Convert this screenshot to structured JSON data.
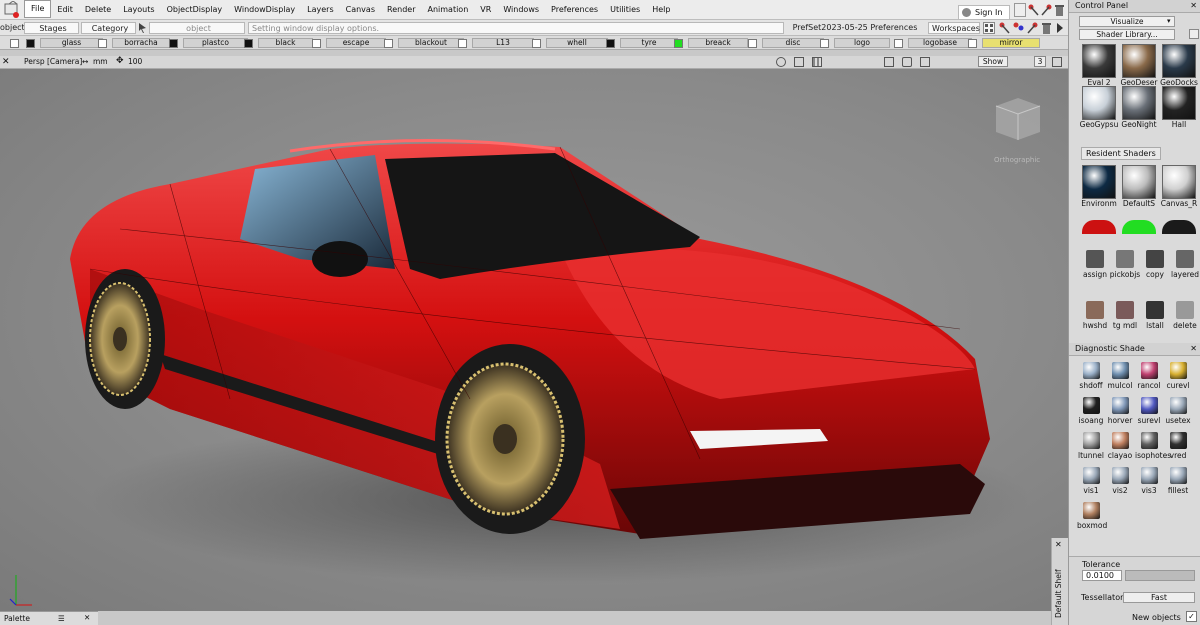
{
  "menu": {
    "items": [
      "File",
      "Edit",
      "Delete",
      "Layouts",
      "ObjectDisplay",
      "WindowDisplay",
      "Layers",
      "Canvas",
      "Render",
      "Animation",
      "VR",
      "Windows",
      "Preferences",
      "Utilities",
      "Help"
    ],
    "sign_in": "Sign In"
  },
  "toolbar": {
    "mode_label": "object",
    "stages": "Stages",
    "category": "Category",
    "object_field": "object",
    "status_text": "Setting window display options.",
    "prefset": "PrefSet2023-05-25 Preferences",
    "workspaces": "Workspaces"
  },
  "layers": [
    "glass",
    "borracha",
    "plastco",
    "black",
    "escape",
    "blackout",
    "L13",
    "whell",
    "tyre",
    "breack",
    "disc",
    "logo",
    "logobase",
    "mirror"
  ],
  "viewport": {
    "camera_label": "Persp [Camera]",
    "units": "mm",
    "zoom_value": "100",
    "viewcube_label": "Orthographic",
    "show_button": "Show",
    "page_number": "3"
  },
  "palette_label": "Palette",
  "side_tab_label": "Default Shelf",
  "control_panel": {
    "title": "Control Panel",
    "visualize": "Visualize",
    "shader_library": "Shader Library...",
    "library_shaders": [
      {
        "name": "Eval 2",
        "color": "#3a3a3a"
      },
      {
        "name": "GeoDeser",
        "color": "#8a6a4a"
      },
      {
        "name": "GeoDocks",
        "color": "#2a3a4a"
      },
      {
        "name": "GeoGypsu",
        "color": "#c8d0d8"
      },
      {
        "name": "GeoNight",
        "color": "#6a7078"
      },
      {
        "name": "Hall",
        "color": "#222222"
      }
    ],
    "resident_header": "Resident Shaders",
    "resident_shaders": [
      {
        "name": "Environm",
        "color": "#0d2a44"
      },
      {
        "name": "DefaultS",
        "color": "#bcbcbc"
      },
      {
        "name": "Canvas_R",
        "color": "#d0d0d0"
      }
    ],
    "resident_row2_colors": [
      "#cc1111",
      "#22dd22",
      "#1a1a1a"
    ],
    "tools_row1": [
      "assign",
      "pickobjs",
      "copy",
      "layered"
    ],
    "tools_row2": [
      "hwshd",
      "tg mdl",
      "lstall",
      "delete"
    ],
    "diagnostic_header": "Diagnostic Shade",
    "diagnostics": [
      {
        "name": "shdoff",
        "color": "#9ab0c8"
      },
      {
        "name": "mulcol",
        "color": "#7090b0"
      },
      {
        "name": "rancol",
        "color": "#c04070"
      },
      {
        "name": "curevl",
        "color": "#d8b030"
      },
      {
        "name": "isoang",
        "color": "#202020"
      },
      {
        "name": "horver",
        "color": "#8098b8"
      },
      {
        "name": "surevl",
        "color": "#5058c0"
      },
      {
        "name": "usetex",
        "color": "#9aa8b8"
      },
      {
        "name": "ltunnel",
        "color": "#a0a0a0"
      },
      {
        "name": "clayao",
        "color": "#c08060"
      },
      {
        "name": "isophotes",
        "color": "#606060"
      },
      {
        "name": "vred",
        "color": "#303030"
      },
      {
        "name": "vis1",
        "color": "#9aa8b8"
      },
      {
        "name": "vis2",
        "color": "#9aa8b8"
      },
      {
        "name": "vis3",
        "color": "#9aa8b8"
      },
      {
        "name": "fillest",
        "color": "#9aa8b8"
      },
      {
        "name": "boxmod",
        "color": "#b08060"
      }
    ],
    "tolerance_label": "Tolerance",
    "tolerance_value": "0.0100",
    "tessellator_label": "Tessellator",
    "tessellator_value": "Fast",
    "new_objects_label": "New objects"
  },
  "colors": {
    "car_red": "#d41010",
    "viewport_bg": "#8c8c8c",
    "accent_green": "#22dd22"
  }
}
